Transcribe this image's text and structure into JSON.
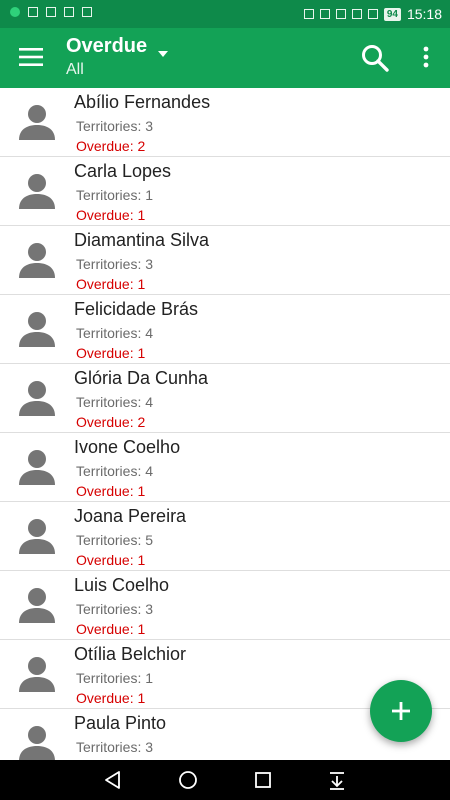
{
  "status_bar": {
    "battery": "94",
    "time": "15:18",
    "icons_left": [
      "whatsapp-icon",
      "usb-icon",
      "usb-icon",
      "gallery-icon",
      "screen-icon"
    ],
    "icons_right": [
      "headset-icon",
      "nfc-icon",
      "vibrate-icon",
      "wifi-icon",
      "signal-icon"
    ]
  },
  "app_bar": {
    "title": "Overdue",
    "subtitle": "All",
    "color": "#13a256"
  },
  "people": [
    {
      "name": "Abílio Fernandes",
      "territories": "Territories: 3",
      "overdue": "Overdue: 2"
    },
    {
      "name": "Carla Lopes",
      "territories": "Territories: 1",
      "overdue": "Overdue: 1"
    },
    {
      "name": "Diamantina Silva",
      "territories": "Territories: 3",
      "overdue": "Overdue: 1"
    },
    {
      "name": "Felicidade Brás",
      "territories": "Territories: 4",
      "overdue": "Overdue: 1"
    },
    {
      "name": "Glória Da Cunha",
      "territories": "Territories: 4",
      "overdue": "Overdue: 2"
    },
    {
      "name": "Ivone Coelho",
      "territories": "Territories: 4",
      "overdue": "Overdue: 1"
    },
    {
      "name": "Joana Pereira",
      "territories": "Territories: 5",
      "overdue": "Overdue: 1"
    },
    {
      "name": "Luis Coelho",
      "territories": "Territories: 3",
      "overdue": "Overdue: 1"
    },
    {
      "name": "Otília Belchior",
      "territories": "Territories: 1",
      "overdue": "Overdue: 1"
    },
    {
      "name": "Paula Pinto",
      "territories": "Territories: 3",
      "overdue": ""
    }
  ],
  "fab": {
    "icon": "plus-icon"
  },
  "nav_bar": {
    "icons": [
      "back-icon",
      "home-icon",
      "recents-icon",
      "notification-pull-icon"
    ]
  }
}
